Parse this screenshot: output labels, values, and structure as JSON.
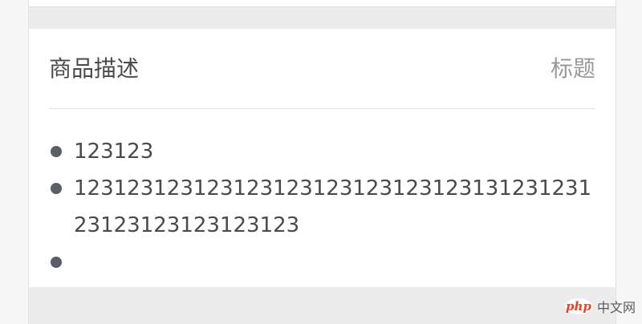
{
  "section": {
    "title": "商品描述",
    "action_label": "标题"
  },
  "description": {
    "items": [
      "123123",
      "12312312312312312312312312312313123123123123123123123123",
      ""
    ]
  },
  "watermark": {
    "logo_text": "php",
    "site_text": "中文网"
  },
  "colors": {
    "page_background": "#ececec",
    "card_background": "#ffffff",
    "title_text": "#4a4a4a",
    "action_text": "#9a9a9a",
    "bullet": "#5a5e66"
  }
}
